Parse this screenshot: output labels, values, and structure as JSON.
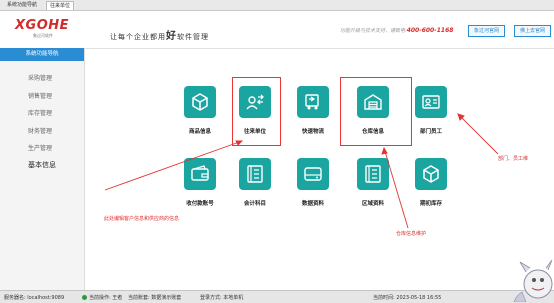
{
  "window": {
    "tabs": [
      "系统功能导航",
      "往来单位"
    ]
  },
  "header": {
    "logo": "XGOHE",
    "logo_sub": "象过河软件",
    "slogan_pre": "让每个企业都用",
    "slogan_em": "好",
    "slogan_post": "软件管理",
    "hotline_text": "功能升级与技术支持，请致电:",
    "hotline_number": "400-600-1168",
    "btn_official": "象过河官网",
    "btn_cloud": "佛上去官网"
  },
  "sidebar": {
    "title": "系统功能导航",
    "items": [
      "采购管理",
      "销售管理",
      "库存管理",
      "财务管理",
      "生产管理",
      "基本信息"
    ]
  },
  "tiles": [
    {
      "label": "商品信息",
      "icon": "package-icon"
    },
    {
      "label": "往来单位",
      "icon": "contacts-exchange-icon"
    },
    {
      "label": "快速物流",
      "icon": "truck-icon"
    },
    {
      "label": "仓库信息",
      "icon": "warehouse-icon"
    },
    {
      "label": "部门员工",
      "icon": "id-card-icon"
    },
    {
      "label": "收付款账号",
      "icon": "wallet-icon"
    },
    {
      "label": "会计科目",
      "icon": "ledger-icon"
    },
    {
      "label": "数据资料",
      "icon": "drive-icon"
    },
    {
      "label": "区域资料",
      "icon": "region-doc-icon"
    },
    {
      "label": "期初库存",
      "icon": "cube-icon"
    }
  ],
  "annotations": {
    "contacts": "此处编辑客户信息和供应商的信息",
    "warehouse": "仓库信息维护",
    "staff": "部门、员工维"
  },
  "colors": {
    "accent": "#2a8dd4",
    "tile": "#1aa5a0",
    "annotation": "#e33333",
    "brand": "#d32a2a"
  },
  "status": {
    "server": "服务器名: localhost:9089",
    "user_label": "当前操作: 王者",
    "account": "当前账套: 数据演示账套",
    "mode": "登录方式: 本地单机",
    "date": "当前时间: 2023-05-18 16:55"
  }
}
